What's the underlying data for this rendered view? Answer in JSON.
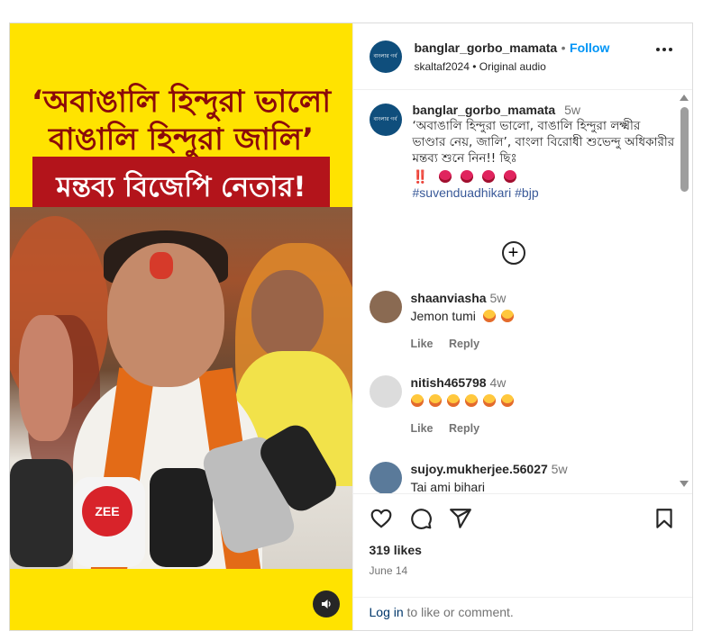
{
  "post": {
    "media": {
      "headline_line1": "‘অবাঙালি হিন্দুরা ভালো",
      "headline_line2": "বাঙালি হিন্দুরা জালি’",
      "banner": "মন্তব্য বিজেপি নেতার!",
      "mic_logo": "ZEE",
      "sound_icon": "speaker-icon"
    },
    "header": {
      "username": "banglar_gorbo_mamata",
      "separator": "•",
      "follow_label": "Follow",
      "audio_user": "skaltaf2024",
      "audio_sep": "•",
      "audio_label": "Original audio",
      "avatar_text": "বাংলার গর্ব মমতা"
    },
    "caption": {
      "username": "banglar_gorbo_mamata",
      "time": "5w",
      "text": "‘অবাঙালি হিন্দুরা ভালো, বাঙালি হিন্দুরা লক্ষ্মীর ভাণ্ডার নেয়, জালি’, বাংলা বিরোধী শুভেন্দু অধিকারীর মন্তব্য শুনে নিন!! ছিঃ",
      "exclaim": "‼️",
      "hashtags": "#suvenduadhikari #bjp"
    },
    "comments": [
      {
        "username": "shaanviasha",
        "time": "5w",
        "text": "Jemon tumi",
        "like": "Like",
        "reply": "Reply",
        "avatar_color": "#8a6a52"
      },
      {
        "username": "nitish465798",
        "time": "4w",
        "text": "",
        "like": "Like",
        "reply": "Reply",
        "avatar_color": "#dcdcdc"
      },
      {
        "username": "sujoy.mukherjee.56027",
        "time": "5w",
        "text": "Tai ami bihari",
        "like": "Like",
        "reply": "Reply",
        "avatar_color": "#5a7a9a"
      }
    ],
    "likes": "319 likes",
    "date": "June 14",
    "login_link": "Log in",
    "login_rest": " to like or comment."
  },
  "colors": {
    "accent": "#0095f6",
    "media_bg": "#ffe300",
    "headline": "#8b0a0a",
    "banner_bg": "#b3141b"
  }
}
